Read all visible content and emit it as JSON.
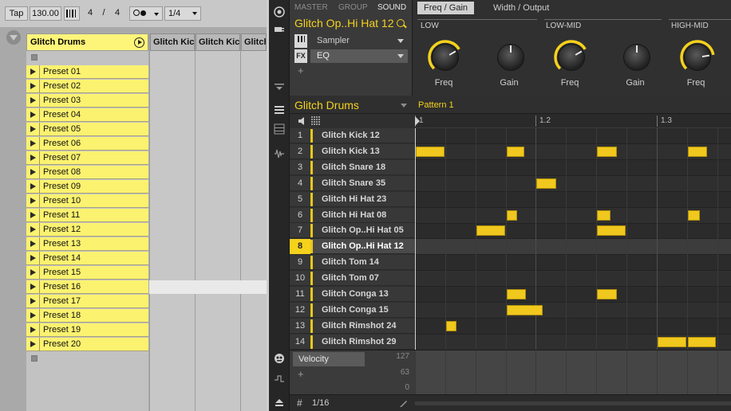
{
  "live": {
    "toolbar": {
      "tap": "Tap",
      "tempo": "130.00",
      "sig_num": "4",
      "sig_sep": "/",
      "sig_den": "4",
      "quantize": "1/4",
      "metronome_icon": "metronome-icon",
      "follow_icon": "follow-icon"
    },
    "track": {
      "name": "Glitch Drums"
    },
    "clips": [
      "Preset 01",
      "Preset 02",
      "Preset 03",
      "Preset 04",
      "Preset 05",
      "Preset 06",
      "Preset 07",
      "Preset 08",
      "Preset 09",
      "Preset 10",
      "Preset 11",
      "Preset 12",
      "Preset 13",
      "Preset 14",
      "Preset 15",
      "Preset 16",
      "Preset 17",
      "Preset 18",
      "Preset 19",
      "Preset 20"
    ],
    "sub_tracks": [
      "Glitch Kic",
      "Glitch Kic",
      "Glitch"
    ]
  },
  "maschine": {
    "tabs": {
      "master": "MASTER",
      "group": "GROUP",
      "sound": "SOUND"
    },
    "sound_name": "Glitch Op..Hi Hat 12",
    "slots": [
      {
        "icon": "sampler-icon",
        "label": "Sampler"
      },
      {
        "icon": "FX",
        "label": "EQ"
      }
    ],
    "add_slot": "+",
    "page_tabs": [
      "Freq / Gain",
      "Width / Output"
    ],
    "bands": [
      "LOW",
      "LOW-MID",
      "HIGH-MID"
    ],
    "knobs": [
      {
        "label": "Freq",
        "value": 0.72,
        "accent": true
      },
      {
        "label": "Gain",
        "value": 0.5,
        "accent": false
      },
      {
        "label": "Freq",
        "value": 0.72,
        "accent": true
      },
      {
        "label": "Gain",
        "value": 0.5,
        "accent": false
      },
      {
        "label": "Freq",
        "value": 0.8,
        "accent": true
      }
    ],
    "group_name": "Glitch Drums",
    "pattern_name": "Pattern 1",
    "ruler_labels": [
      "1",
      "1.2",
      "1.3"
    ],
    "selected_pad": 8,
    "pads": [
      {
        "num": "1",
        "name": "Glitch Kick 12"
      },
      {
        "num": "2",
        "name": "Glitch Kick 13"
      },
      {
        "num": "3",
        "name": "Glitch Snare 18"
      },
      {
        "num": "4",
        "name": "Glitch Snare 35"
      },
      {
        "num": "5",
        "name": "Glitch Hi Hat 23"
      },
      {
        "num": "6",
        "name": "Glitch Hi Hat 08"
      },
      {
        "num": "7",
        "name": "Glitch Op..Hi Hat 05"
      },
      {
        "num": "8",
        "name": "Glitch Op..Hi Hat 12"
      },
      {
        "num": "9",
        "name": "Glitch Tom 14"
      },
      {
        "num": "10",
        "name": "Glitch Tom 07"
      },
      {
        "num": "11",
        "name": "Glitch Conga 13"
      },
      {
        "num": "12",
        "name": "Glitch Conga 15"
      },
      {
        "num": "13",
        "name": "Glitch Rimshot 24"
      },
      {
        "num": "14",
        "name": "Glitch Rimshot 29"
      }
    ],
    "notes": [
      {
        "row": 2,
        "step": 0,
        "len": 1
      },
      {
        "row": 2,
        "step": 3,
        "len": 0.65
      },
      {
        "row": 2,
        "step": 6,
        "len": 0.7
      },
      {
        "row": 2,
        "step": 9,
        "len": 0.7
      },
      {
        "row": 4,
        "step": 4,
        "len": 0.7
      },
      {
        "row": 6,
        "step": 3,
        "len": 0.4
      },
      {
        "row": 6,
        "step": 6,
        "len": 0.5
      },
      {
        "row": 6,
        "step": 9,
        "len": 0.45
      },
      {
        "row": 7,
        "step": 2,
        "len": 1
      },
      {
        "row": 7,
        "step": 6,
        "len": 1
      },
      {
        "row": 11,
        "step": 3,
        "len": 0.7
      },
      {
        "row": 11,
        "step": 6,
        "len": 0.7
      },
      {
        "row": 12,
        "step": 3,
        "len": 1.25
      },
      {
        "row": 13,
        "step": 1,
        "len": 0.4
      },
      {
        "row": 14,
        "step": 8,
        "len": 1
      },
      {
        "row": 14,
        "step": 9,
        "len": 1
      }
    ],
    "velocity": {
      "label": "Velocity",
      "add": "+",
      "max": "127",
      "mid": "63",
      "min": "0"
    },
    "footer": {
      "grid_icon": "#",
      "resolution": "1/16"
    }
  }
}
